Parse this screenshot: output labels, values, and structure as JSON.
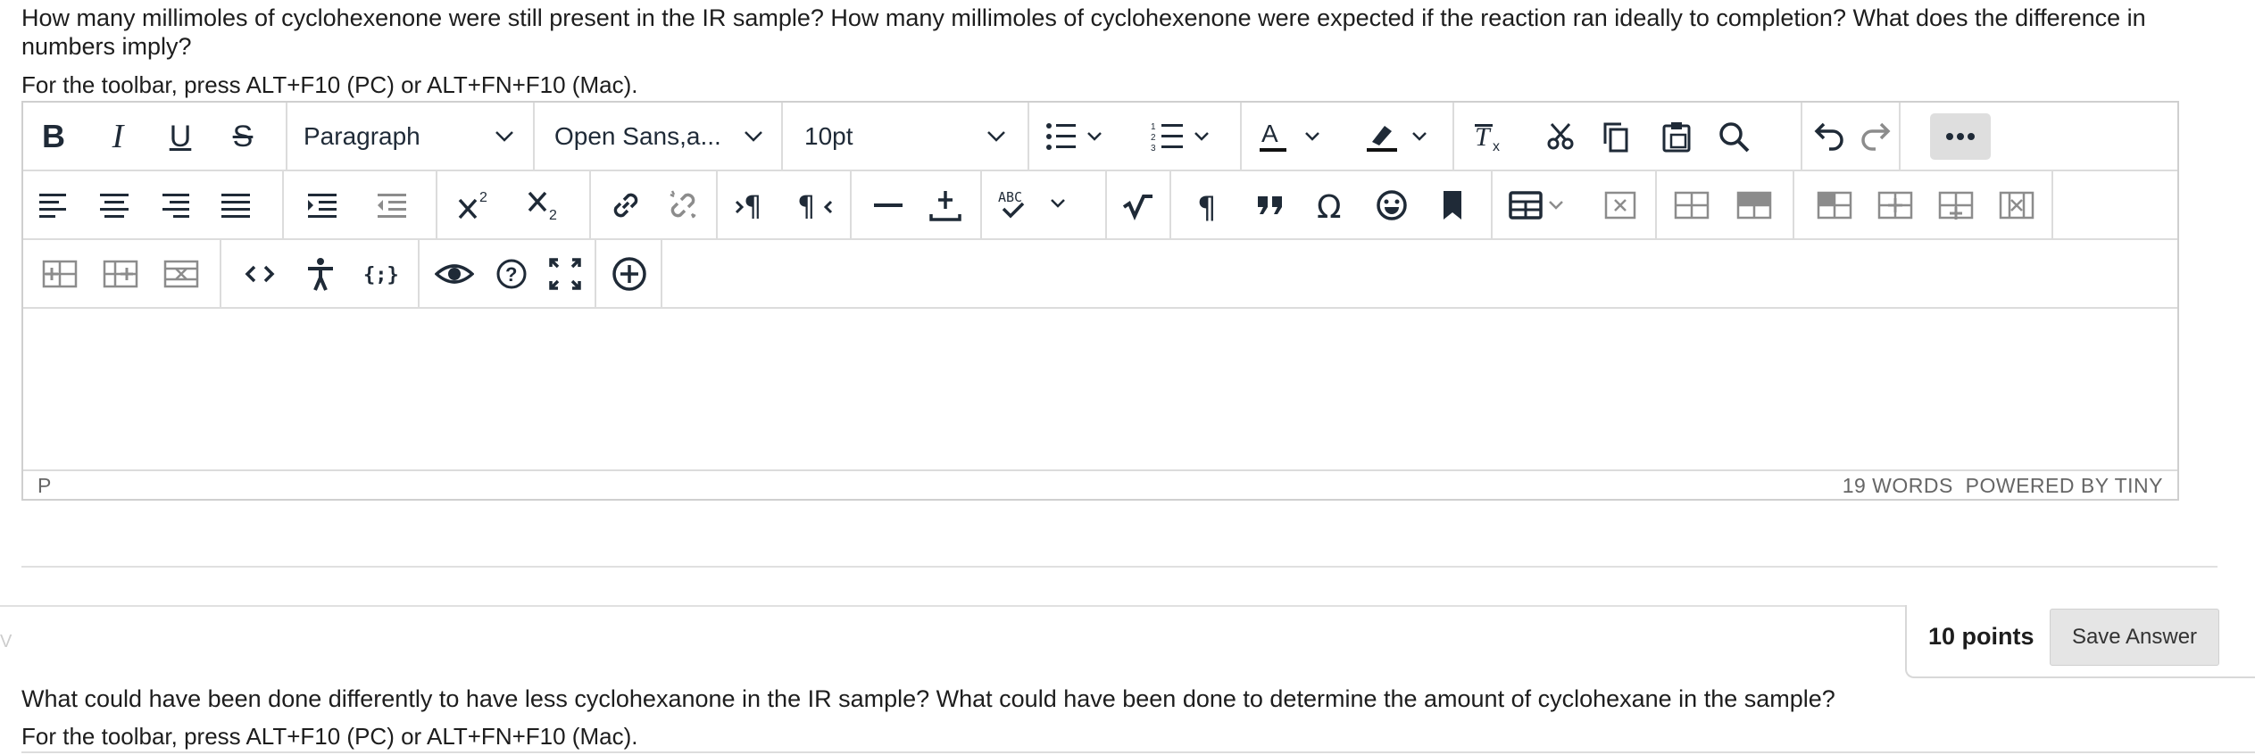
{
  "question1": {
    "text": "How many millimoles of cyclohexenone were still present in the IR sample?  How many millimoles of cyclohexenone were expected if the reaction ran ideally to completion?  What does the difference in numbers imply?",
    "toolbar_hint": "For the toolbar, press ALT+F10 (PC) or ALT+FN+F10 (Mac)."
  },
  "toolbar": {
    "block_format": "Paragraph",
    "font_family": "Open Sans,a...",
    "font_size": "10pt",
    "row1_icons": [
      "bold-icon",
      "italic-icon",
      "underline-icon",
      "strikethrough-icon",
      "bullet-list-icon",
      "numbered-list-icon",
      "text-color-icon",
      "highlight-icon",
      "clear-formatting-icon",
      "cut-icon",
      "copy-icon",
      "paste-icon",
      "search-icon",
      "undo-icon",
      "redo-icon",
      "more-icon"
    ],
    "row2_icons": [
      "align-left-icon",
      "align-center-icon",
      "align-right-icon",
      "justify-icon",
      "indent-icon",
      "outdent-icon",
      "superscript-icon",
      "subscript-icon",
      "link-icon",
      "unlink-icon",
      "ltr-icon",
      "rtl-icon",
      "horizontal-rule-icon",
      "insert-icon",
      "spellcheck-icon",
      "math-icon",
      "show-blocks-icon",
      "blockquote-icon",
      "special-char-icon",
      "emoji-icon",
      "bookmark-icon",
      "table-icon",
      "delete-table-icon",
      "row-props-icon",
      "cell-props-icon",
      "insert-row-before-icon",
      "insert-row-after-icon",
      "insert-col-icon",
      "delete-col-icon"
    ],
    "row3_icons": [
      "insert-col-before-icon",
      "insert-col-after-icon",
      "delete-row-icon",
      "code-icon",
      "accessibility-icon",
      "template-icon",
      "preview-icon",
      "help-icon",
      "fullscreen-icon",
      "add-icon"
    ],
    "spellcheck_label": "ABC"
  },
  "editor": {
    "status_path": "P",
    "word_count": "19 WORDS",
    "powered_by": "POWERED BY TINY"
  },
  "question2_header": {
    "points": "10 points",
    "save_label": "Save Answer"
  },
  "question2": {
    "text": "What could have been done differently to have less cyclohexanone in the IR sample?  What could have been done to determine the amount of cyclohexane in the sample?",
    "toolbar_hint": "For the toolbar, press ALT+F10 (PC) or ALT+FN+F10 (Mac)."
  },
  "stub_mark": "V",
  "colors": {
    "accent": "#1f2a37",
    "border": "#cfcfcf",
    "button_bg": "#e5e5e5"
  }
}
